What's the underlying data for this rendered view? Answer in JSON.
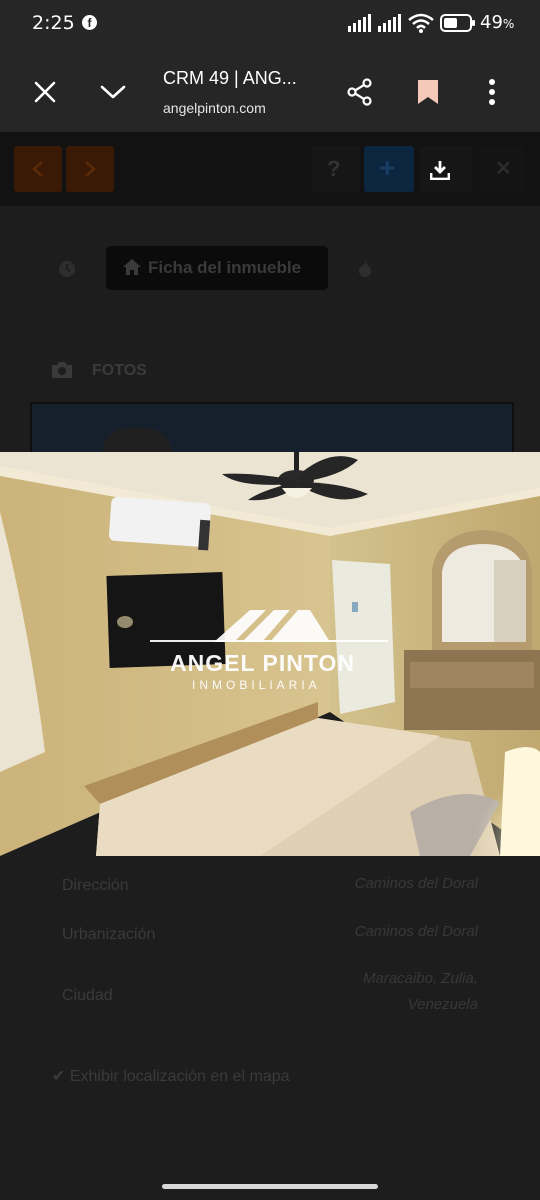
{
  "status_bar": {
    "time": "2:25",
    "battery_percent": "49",
    "battery_suffix": "%",
    "notification_icon": "facebook-icon"
  },
  "browser": {
    "title": "CRM 49 | ANG...",
    "url": "angelpinton.com"
  },
  "page": {
    "tab_label": "Ficha del inmueble",
    "photos_label": "FOTOS",
    "watermark": {
      "brand": "ANGEL PINTON",
      "subtitle": "INMOBILIARIA"
    },
    "details": [
      {
        "label": "Dirección",
        "value": "Caminos del Doral"
      },
      {
        "label": "Urbanización",
        "value": "Caminos del Doral"
      },
      {
        "label": "Ciudad",
        "value_line1": "Maracaibo, Zulia,",
        "value_line2": "Venezuela"
      }
    ],
    "map_option": "Exhibir localización en el mapa"
  },
  "colors": {
    "status_bg": "#262626",
    "page_bg": "#1d1d1d",
    "accent_orange": "#3a1a05",
    "accent_blue": "#0d2640"
  }
}
